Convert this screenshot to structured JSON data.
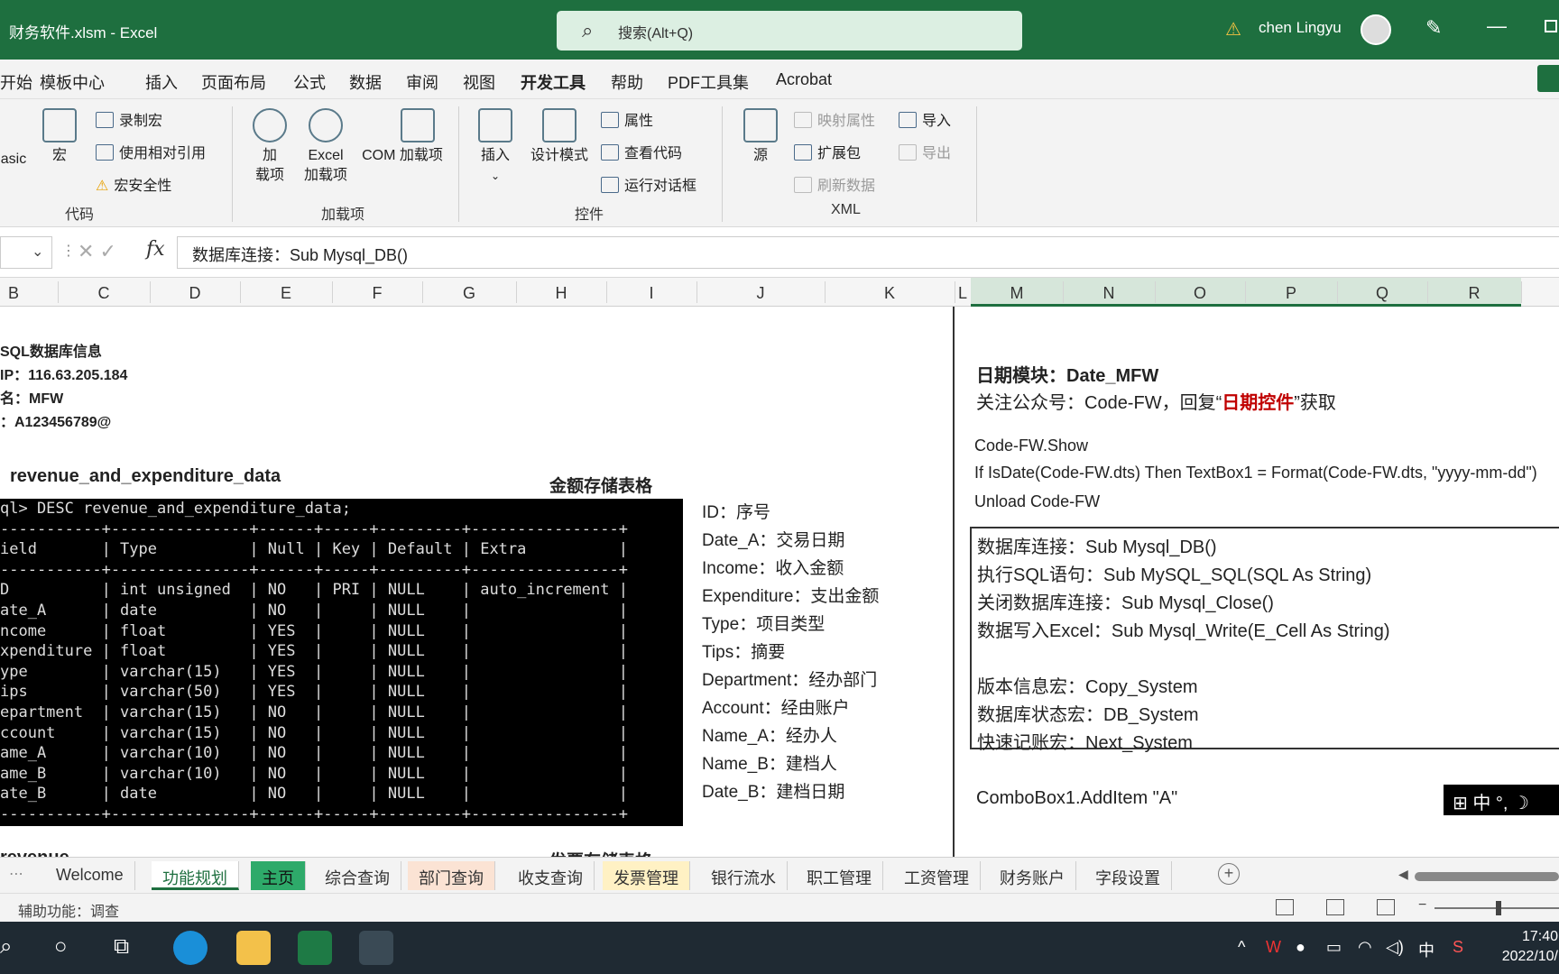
{
  "window": {
    "title": "财务软件.xlsm  -  Excel",
    "search_placeholder": "搜索(Alt+Q)",
    "user": "chen Lingyu"
  },
  "menu": [
    "开始",
    "模板中心",
    "插入",
    "页面布局",
    "公式",
    "数据",
    "审阅",
    "视图",
    "开发工具",
    "帮助",
    "PDF工具集",
    "Acrobat"
  ],
  "menu_active": "开发工具",
  "ribbon": {
    "code": {
      "basic": "asic",
      "macro": "宏",
      "record": "录制宏",
      "relative": "使用相对引用",
      "security": "宏安全性",
      "group": "代码"
    },
    "addins": {
      "addin_line1": "加",
      "addin_line2": "载项",
      "excel_line1": "Excel",
      "excel_line2": "加载项",
      "com": "COM 加载项",
      "group": "加载项"
    },
    "controls": {
      "insert": "插入",
      "design": "设计模式",
      "props": "属性",
      "view_code": "查看代码",
      "run_dialog": "运行对话框",
      "group": "控件"
    },
    "xml": {
      "source": "源",
      "map_props": "映射属性",
      "expand": "扩展包",
      "refresh": "刷新数据",
      "import": "导入",
      "export": "导出",
      "group": "XML"
    }
  },
  "formula": {
    "content": "数据库连接：Sub Mysql_DB()"
  },
  "columns": [
    "B",
    "C",
    "D",
    "E",
    "F",
    "G",
    "H",
    "I",
    "J",
    "K",
    "L",
    "M",
    "N",
    "O",
    "P",
    "Q",
    "R"
  ],
  "left_info": {
    "title": "SQL数据库信息",
    "ip": "IP：116.63.205.184",
    "name": "名：MFW",
    "pwd": "：A123456789@",
    "table": "revenue_and_expenditure_data",
    "store": "金额存储表格",
    "bottom_left": "revenue",
    "bottom_right": "发票存储表格"
  },
  "console": {
    "lines": [
      "ql> DESC revenue_and_expenditure_data;",
      "-----------+---------------+------+-----+---------+----------------+",
      "ield       | Type          | Null | Key | Default | Extra          |",
      "-----------+---------------+------+-----+---------+----------------+",
      "D          | int unsigned  | NO   | PRI | NULL    | auto_increment |",
      "ate_A      | date          | NO   |     | NULL    |                |",
      "ncome      | float         | YES  |     | NULL    |                |",
      "xpenditure | float         | YES  |     | NULL    |                |",
      "ype        | varchar(15)   | YES  |     | NULL    |                |",
      "ips        | varchar(50)   | YES  |     | NULL    |                |",
      "epartment  | varchar(15)   | NO   |     | NULL    |                |",
      "ccount     | varchar(15)   | NO   |     | NULL    |                |",
      "ame_A      | varchar(10)   | NO   |     | NULL    |                |",
      "ame_B      | varchar(10)   | NO   |     | NULL    |                |",
      "ate_B      | date          | NO   |     | NULL    |                |",
      "-----------+---------------+------+-----+---------+----------------+"
    ]
  },
  "fields": [
    "ID：序号",
    "Date_A：交易日期",
    "Income：收入金额",
    "Expenditure：支出金额",
    "Type：项目类型",
    "Tips：摘要",
    "Department：经办部门",
    "Account：经由账户",
    "Name_A：经办人",
    "Name_B：建档人",
    "Date_B：建档日期"
  ],
  "right": {
    "date_title": "日期模块：Date_MFW",
    "follow_pre": "关注公众号：Code-FW，回复“",
    "follow_red": "日期控件",
    "follow_post": "”获取",
    "code1": "Code-FW.Show",
    "code2": "If IsDate(Code-FW.dts) Then TextBox1 = Format(Code-FW.dts, \"yyyy-mm-dd\")",
    "code3": "Unload Code-FW",
    "box": [
      "数据库连接：Sub Mysql_DB()",
      "执行SQL语句：Sub MySQL_SQL(SQL As String)",
      "关闭数据库连接：Sub Mysql_Close()",
      "数据写入Excel：Sub Mysql_Write(E_Cell As String)",
      "",
      "版本信息宏：Copy_System",
      "数据库状态宏：DB_System",
      "快速记账宏：Next_System"
    ],
    "combo": "ComboBox1.AddItem \"A\"",
    "ime": "中 °, ☽"
  },
  "tabs": [
    {
      "label": "Welcome",
      "color": "#f3f3f3"
    },
    {
      "label": "功能规划",
      "color": "#ffffff"
    },
    {
      "label": "主页",
      "color": "#2eaa6a"
    },
    {
      "label": "综合查询",
      "color": "#f3f3f3"
    },
    {
      "label": "部门查询",
      "color": "#fbe3d4"
    },
    {
      "label": "收支查询",
      "color": "#f3f3f3"
    },
    {
      "label": "发票管理",
      "color": "#fff1c4"
    },
    {
      "label": "银行流水",
      "color": "#f3f3f3"
    },
    {
      "label": "职工管理",
      "color": "#f3f3f3"
    },
    {
      "label": "工资管理",
      "color": "#f3f3f3"
    },
    {
      "label": "财务账户",
      "color": "#f3f3f3"
    },
    {
      "label": "字段设置",
      "color": "#f3f3f3"
    }
  ],
  "status": {
    "accessibility": "辅助功能：调查"
  },
  "taskbar": {
    "time": "17:40",
    "date": "2022/10/",
    "ime": "中"
  }
}
